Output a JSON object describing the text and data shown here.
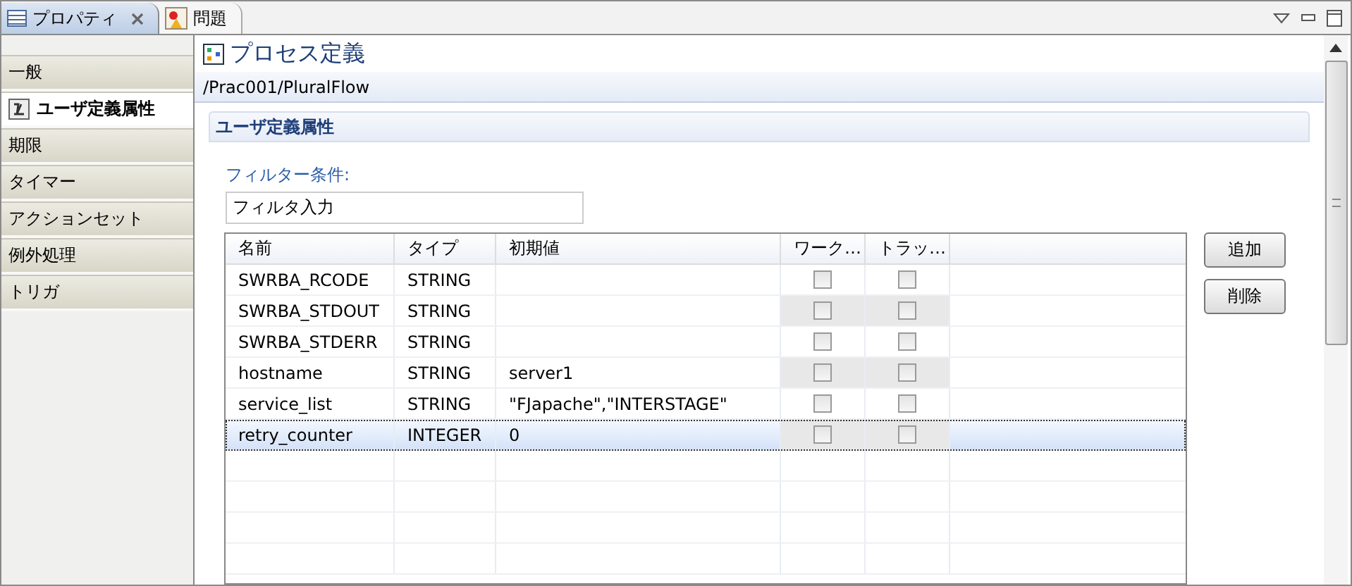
{
  "tabs": [
    {
      "label": "プロパティ",
      "selected": true,
      "closable": true
    },
    {
      "label": "問題",
      "selected": false,
      "closable": false
    }
  ],
  "sidebar": {
    "items": [
      {
        "label": "一般",
        "selected": false
      },
      {
        "label": "ユーザ定義属性",
        "selected": true
      },
      {
        "label": "期限",
        "selected": false
      },
      {
        "label": "タイマー",
        "selected": false
      },
      {
        "label": "アクションセット",
        "selected": false
      },
      {
        "label": "例外処理",
        "selected": false
      },
      {
        "label": "トリガ",
        "selected": false
      }
    ]
  },
  "header": {
    "title": "プロセス定義",
    "path": "/Prac001/PluralFlow"
  },
  "section": {
    "title": "ユーザ定義属性",
    "filter_label": "フィルター条件:",
    "filter_value": "フィルタ入力"
  },
  "table": {
    "columns": [
      "名前",
      "タイプ",
      "初期値",
      "ワーク…",
      "トラッ…"
    ],
    "rows": [
      {
        "name": "SWRBA_RCODE",
        "type": "STRING",
        "initial": "",
        "work": false,
        "track": false,
        "selected": false
      },
      {
        "name": "SWRBA_STDOUT",
        "type": "STRING",
        "initial": "",
        "work": false,
        "track": false,
        "selected": false
      },
      {
        "name": "SWRBA_STDERR",
        "type": "STRING",
        "initial": "",
        "work": false,
        "track": false,
        "selected": false
      },
      {
        "name": "hostname",
        "type": "STRING",
        "initial": "server1",
        "work": false,
        "track": false,
        "selected": false
      },
      {
        "name": "service_list",
        "type": "STRING",
        "initial": "\"FJapache\",\"INTERSTAGE\"",
        "work": false,
        "track": false,
        "selected": false
      },
      {
        "name": "retry_counter",
        "type": "INTEGER",
        "initial": "0",
        "work": false,
        "track": false,
        "selected": true
      }
    ]
  },
  "buttons": [
    "追加",
    "削除"
  ]
}
